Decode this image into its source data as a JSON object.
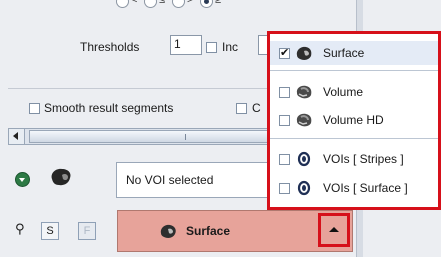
{
  "thresholds": {
    "label": "Thresholds",
    "value": "1",
    "inc_label": "Inc"
  },
  "smooth": {
    "label": "Smooth result segments",
    "next_label": "C"
  },
  "voi": {
    "selected": "No VOI selected"
  },
  "buttons": {
    "s_label": "S",
    "f_label": "F"
  },
  "surface_button": {
    "label": "Surface"
  },
  "menu": {
    "items": [
      {
        "label": "Surface",
        "checked": true,
        "icon": "surface-icon"
      },
      {
        "label": "Volume",
        "checked": false,
        "icon": "volume-icon"
      },
      {
        "label": "Volume HD",
        "checked": false,
        "icon": "volume-hd-icon"
      },
      {
        "label": "VOIs [ Stripes ]",
        "checked": false,
        "icon": "voi-stripes-icon"
      },
      {
        "label": "VOIs [ Surface ]",
        "checked": false,
        "icon": "voi-surface-icon"
      }
    ]
  },
  "colors": {
    "highlight_red": "#d6101a",
    "surface_button_bg": "#e7a39a"
  }
}
